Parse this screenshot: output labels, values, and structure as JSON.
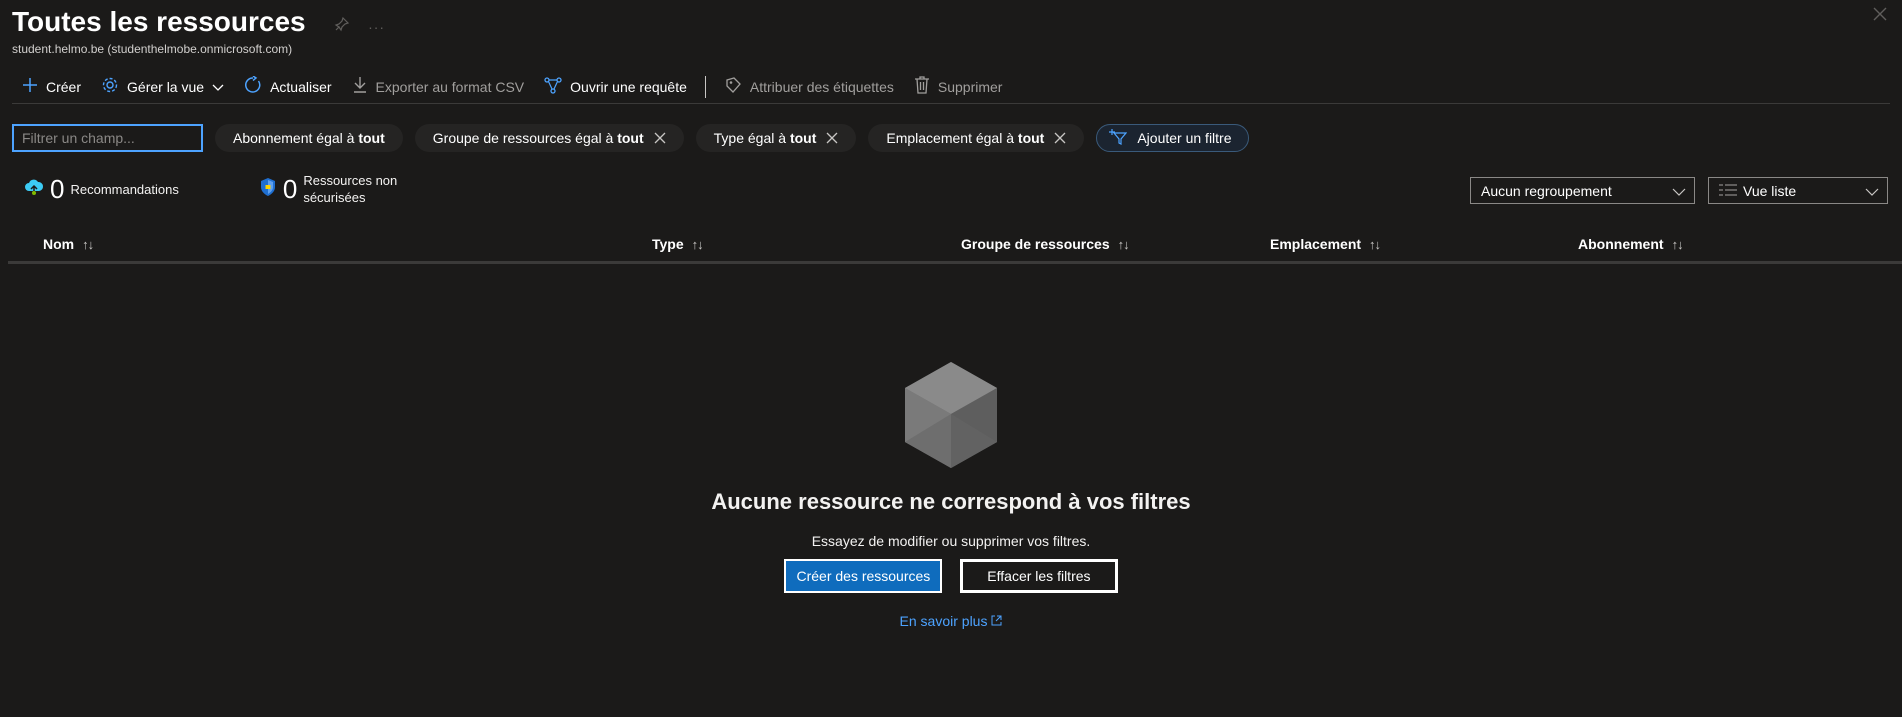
{
  "header": {
    "title": "Toutes les ressources",
    "subtitle": "student.helmo.be (studenthelmobe.onmicrosoft.com)"
  },
  "toolbar": {
    "create": "Créer",
    "manage_view": "Gérer la vue",
    "refresh": "Actualiser",
    "export_csv": "Exporter au format CSV",
    "open_query": "Ouvrir une requête",
    "assign_tags": "Attribuer des étiquettes",
    "delete": "Supprimer"
  },
  "filters": {
    "placeholder": "Filtrer un champ...",
    "items": [
      {
        "prefix": "Abonnement égal à ",
        "value": "tout"
      },
      {
        "prefix": "Groupe de ressources égal à ",
        "value": "tout"
      },
      {
        "prefix": "Type égal à ",
        "value": "tout"
      },
      {
        "prefix": "Emplacement égal à ",
        "value": "tout"
      }
    ],
    "add_filter": "Ajouter un filtre"
  },
  "summary": {
    "recommendations_count": "0",
    "recommendations_label": "Recommandations",
    "unsecured_count": "0",
    "unsecured_label_1": "Ressources non",
    "unsecured_label_2": "sécurisées"
  },
  "dropdowns": {
    "grouping": "Aucun regroupement",
    "view": "Vue liste"
  },
  "table": {
    "columns": [
      "Nom",
      "Type",
      "Groupe de ressources",
      "Emplacement",
      "Abonnement"
    ]
  },
  "empty": {
    "title": "Aucune ressource ne correspond à vos filtres",
    "subtitle": "Essayez de modifier ou supprimer vos filtres.",
    "create_button": "Créer des ressources",
    "clear_button": "Effacer les filtres",
    "learn_more": "En savoir plus"
  },
  "colors": {
    "background": "#1b1a19",
    "accent": "#4da3ff",
    "primary_button": "#0f6cbd"
  }
}
